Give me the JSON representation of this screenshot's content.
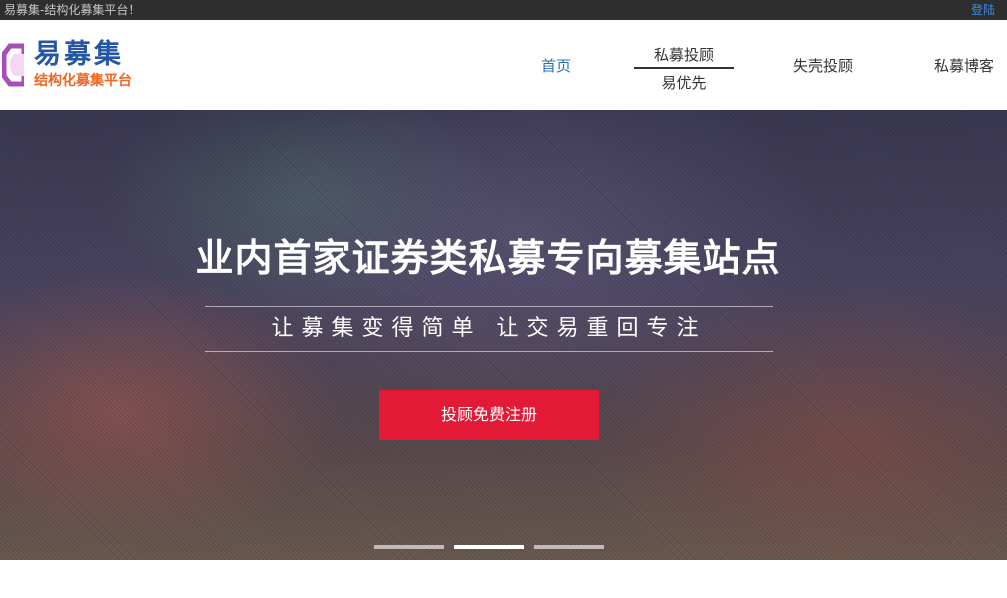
{
  "topbar": {
    "tagline": "易募集-结构化募集平台！",
    "login": "登陆"
  },
  "logo": {
    "name": "易募集",
    "slogan": "结构化募集平台",
    "colors": {
      "name": "#2456a8",
      "slogan": "#f26522",
      "mark": "#a64fb8"
    }
  },
  "nav": {
    "home": "首页",
    "advisor": "私募投顾",
    "yiyouxian": "易优先",
    "shike": "失壳投顾",
    "blog": "私募博客"
  },
  "banner": {
    "title": "业内首家证券类私募专向募集站点",
    "subtitle": "让募集变得简单 让交易重回专注",
    "register_button": "投顾免费注册",
    "button_color": "#e31a35",
    "slides": 3,
    "active_slide": 2
  }
}
